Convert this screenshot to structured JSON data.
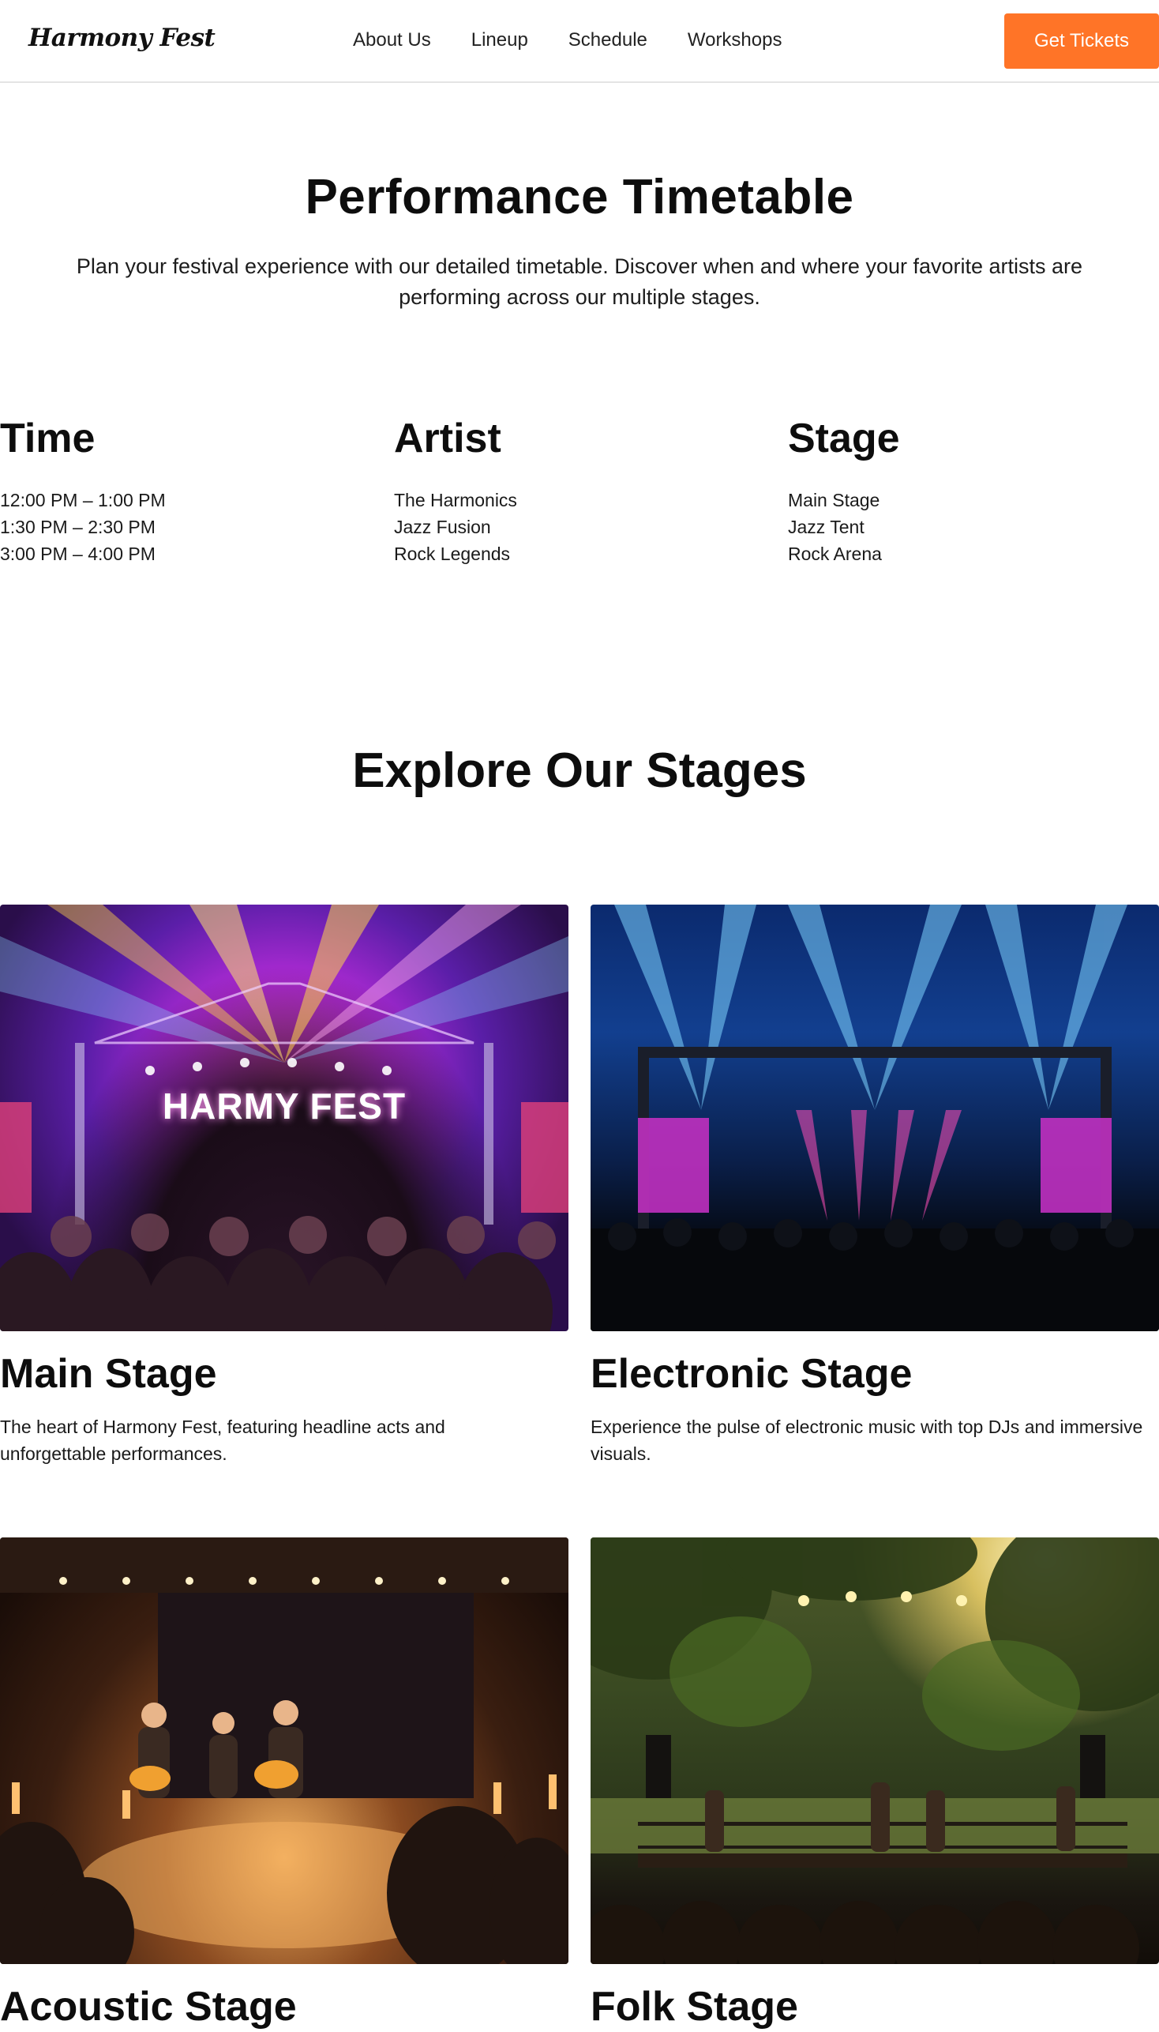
{
  "header": {
    "logo": "Harmony Fest",
    "nav": [
      "About Us",
      "Lineup",
      "Schedule",
      "Workshops"
    ],
    "cta": "Get Tickets",
    "cta_color": "#ff7427"
  },
  "timetable": {
    "title": "Performance Timetable",
    "description": "Plan your festival experience with our detailed timetable. Discover when and where your favorite artists are performing across our multiple stages.",
    "columns": {
      "time": {
        "heading": "Time",
        "rows": [
          "12:00 PM – 1:00 PM",
          "1:30 PM – 2:30 PM",
          "3:00 PM – 4:00 PM"
        ]
      },
      "artist": {
        "heading": "Artist",
        "rows": [
          "The Harmonics",
          "Jazz Fusion",
          "Rock Legends"
        ]
      },
      "stage": {
        "heading": "Stage",
        "rows": [
          "Main Stage",
          "Jazz Tent",
          "Rock Arena"
        ]
      }
    }
  },
  "stages": {
    "title": "Explore Our Stages",
    "cards": [
      {
        "name": "Main Stage",
        "description": "The heart of Harmony Fest, featuring headline acts and unforgettable performances.",
        "image_sign": "HARMY FEST"
      },
      {
        "name": "Electronic Stage",
        "description": "Experience the pulse of electronic music with top DJs and immersive visuals."
      },
      {
        "name": "Acoustic Stage"
      },
      {
        "name": "Folk Stage"
      }
    ]
  }
}
